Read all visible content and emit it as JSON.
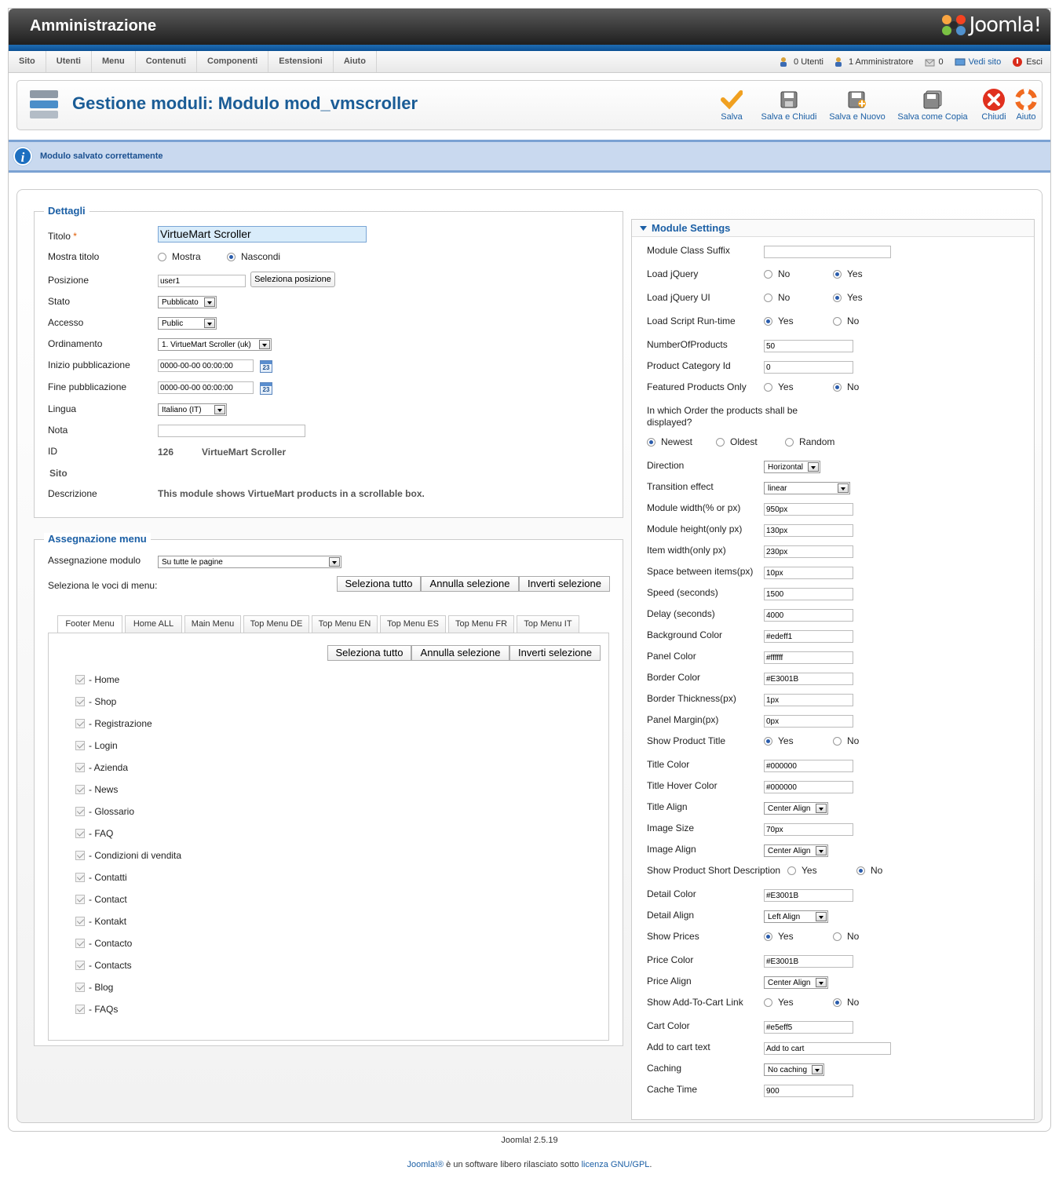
{
  "header": {
    "title": "Amministrazione",
    "logo_text": "Joomla!"
  },
  "menu": [
    "Sito",
    "Utenti",
    "Menu",
    "Contenuti",
    "Componenti",
    "Estensioni",
    "Aiuto"
  ],
  "status": {
    "users": "0 Utenti",
    "admins": "1 Amministratore",
    "messages": "0",
    "view_site": "Vedi sito",
    "logout": "Esci"
  },
  "page": {
    "title": "Gestione moduli: Modulo mod_vmscroller"
  },
  "toolbar": {
    "save": "Salva",
    "save_close": "Salva e Chiudi",
    "save_new": "Salva e Nuovo",
    "save_copy": "Salva come Copia",
    "close": "Chiudi",
    "help": "Aiuto"
  },
  "message": "Modulo salvato correttamente",
  "details": {
    "legend": "Dettagli",
    "title_label": "Titolo",
    "required": "*",
    "title_value": "VirtueMart  Scroller",
    "showtitle_label": "Mostra titolo",
    "show": "Mostra",
    "hide": "Nascondi",
    "position_label": "Posizione",
    "position_value": "user1",
    "select_position": "Seleziona posizione",
    "state_label": "Stato",
    "state_value": "Pubblicato",
    "access_label": "Accesso",
    "access_value": "Public",
    "ordering_label": "Ordinamento",
    "ordering_value": "1. VirtueMart Scroller (uk)",
    "publish_up_label": "Inizio pubblicazione",
    "publish_up": "0000-00-00 00:00:00",
    "publish_down_label": "Fine pubblicazione",
    "publish_down": "0000-00-00 00:00:00",
    "lang_label": "Lingua",
    "lang_value": "Italiano (IT)",
    "note_label": "Nota",
    "note_value": "",
    "id_label": "ID",
    "id_value": "126",
    "id_name": "VirtueMart  Scroller",
    "site_label": "Sito",
    "desc_label": "Descrizione",
    "desc_value": "This module shows VirtueMart products in a scrollable box.",
    "cal_icon": "23"
  },
  "assign": {
    "legend": "Assegnazione menu",
    "module_label": "Assegnazione modulo",
    "module_value": "Su tutte le pagine",
    "select_label": "Seleziona le voci di menu:",
    "select_all": "Seleziona tutto",
    "deselect": "Annulla selezione",
    "invert": "Inverti selezione",
    "tabs": [
      "Footer Menu",
      "Home ALL",
      "Main Menu",
      "Top Menu DE",
      "Top Menu EN",
      "Top Menu ES",
      "Top Menu FR",
      "Top Menu IT"
    ],
    "items": [
      "- Home",
      "- Shop",
      "- Registrazione",
      "- Login",
      "- Azienda",
      "- News",
      "- Glossario",
      "- FAQ",
      "- Condizioni di vendita",
      "- Contatti",
      "- Contact",
      "- Kontakt",
      "- Contacto",
      "- Contacts",
      "- Blog",
      "- FAQs"
    ]
  },
  "settings": {
    "legend": "Module Settings",
    "class_suffix": "Module Class Suffix",
    "class_suffix_value": "",
    "load_jquery": "Load jQuery",
    "load_jquery_ui": "Load jQuery UI",
    "load_script": "Load Script Run-time",
    "no": "No",
    "yes": "Yes",
    "num_products": "NumberOfProducts",
    "num_products_value": "50",
    "category_id": "Product Category Id",
    "category_id_value": "0",
    "featured": "Featured Products Only",
    "order_label": "In which Order the products shall be displayed?",
    "newest": "Newest",
    "oldest": "Oldest",
    "random": "Random",
    "direction": "Direction",
    "direction_value": "Horizontal",
    "transition": "Transition effect",
    "transition_value": "linear",
    "width": "Module width(% or px)",
    "width_value": "950px",
    "height": "Module height(only px)",
    "height_value": "130px",
    "item_width": "Item width(only px)",
    "item_width_value": "230px",
    "space": "Space between items(px)",
    "space_value": "10px",
    "speed": "Speed (seconds)",
    "speed_value": "1500",
    "delay": "Delay (seconds)",
    "delay_value": "4000",
    "bg_color": "Background Color",
    "bg_color_value": "#edeff1",
    "panel_color": "Panel Color",
    "panel_color_value": "#ffffff",
    "border_color": "Border Color",
    "border_color_value": "#E3001B",
    "border_thick": "Border Thickness(px)",
    "border_thick_value": "1px",
    "panel_margin": "Panel Margin(px)",
    "panel_margin_value": "0px",
    "show_title": "Show Product Title",
    "title_color": "Title Color",
    "title_color_value": "#000000",
    "title_hover": "Title Hover Color",
    "title_hover_value": "#000000",
    "title_align": "Title Align",
    "title_align_value": "Center Align",
    "image_size": "Image Size",
    "image_size_value": "70px",
    "image_align": "Image Align",
    "image_align_value": "Center Align",
    "show_desc": "Show Product Short Description",
    "detail_color": "Detail Color",
    "detail_color_value": "#E3001B",
    "detail_align": "Detail Align",
    "detail_align_value": "Left Align",
    "show_prices": "Show Prices",
    "price_color": "Price Color",
    "price_color_value": "#E3001B",
    "price_align": "Price Align",
    "price_align_value": "Center Align",
    "show_cart": "Show Add-To-Cart Link",
    "cart_color": "Cart Color",
    "cart_color_value": "#e5eff5",
    "cart_text": "Add to cart text",
    "cart_text_value": "Add to cart",
    "caching": "Caching",
    "caching_value": "No caching",
    "cache_time": "Cache Time",
    "cache_time_value": "900"
  },
  "footer": {
    "version": "Joomla! 2.5.19",
    "joomla": "Joomla!®",
    "middle": " è un software libero rilasciato sotto ",
    "license": "licenza GNU/GPL",
    "end": "."
  }
}
